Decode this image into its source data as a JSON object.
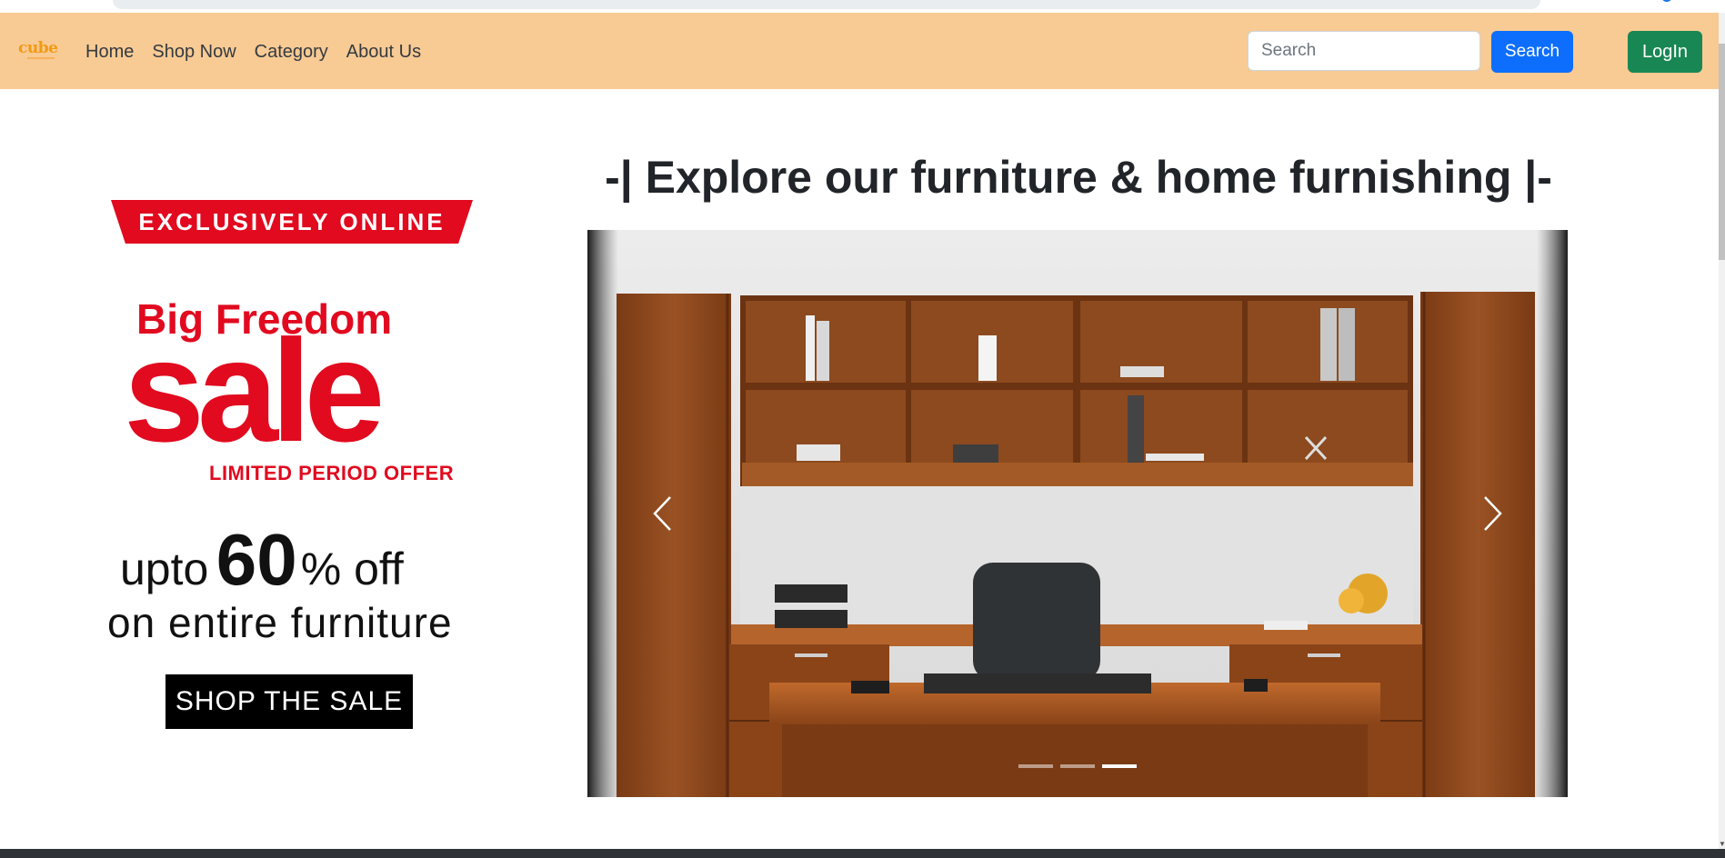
{
  "navbar": {
    "logo_text": "cube",
    "links": [
      "Home",
      "Shop Now",
      "Category",
      "About Us"
    ],
    "search_placeholder": "Search",
    "search_button": "Search",
    "login_button": "LogIn",
    "background": "#f8ca94"
  },
  "sale": {
    "ribbon": "EXCLUSIVELY ONLINE",
    "big_freedom": "Big Freedom",
    "sale_word": "sale",
    "limited": "LIMITED PERIOD OFFER",
    "upto": "upto",
    "percent": "60",
    "off": "% off",
    "entire": "on entire furniture",
    "cta": "SHOP THE SALE",
    "accent_color": "#e10a1f"
  },
  "main": {
    "title": "-| Explore our furniture & home furnishing |-"
  },
  "carousel": {
    "slide_count": 3,
    "active_index": 2,
    "prev_icon": "chevron-left-icon",
    "next_icon": "chevron-right-icon"
  },
  "colors": {
    "search_button": "#0d6efd",
    "login_button": "#198754"
  }
}
